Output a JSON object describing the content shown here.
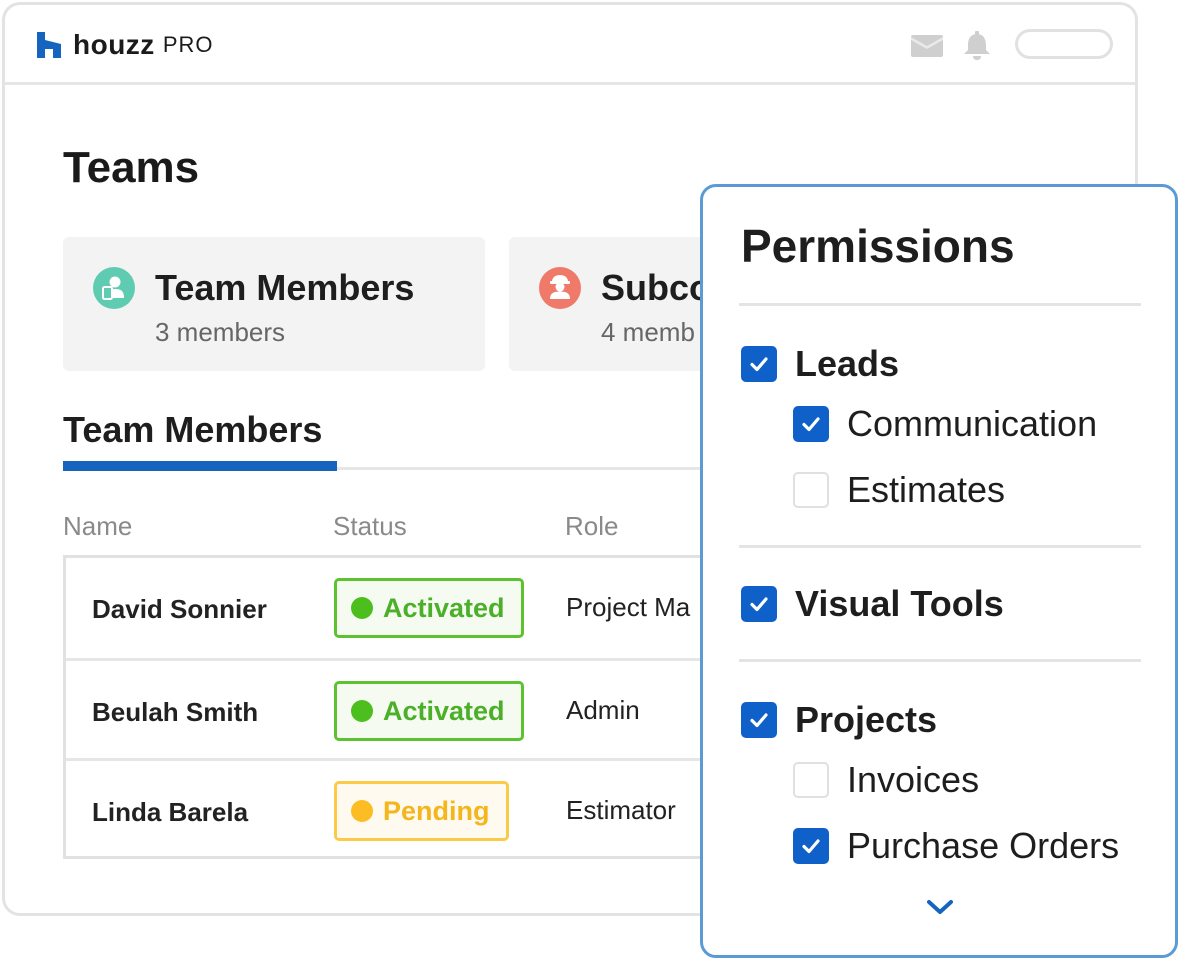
{
  "header": {
    "logo_word": "houzz",
    "logo_suffix": "PRO",
    "icons": [
      "mail-icon",
      "bell-icon",
      "search-input"
    ]
  },
  "page": {
    "title": "Teams"
  },
  "cards": [
    {
      "title": "Team Members",
      "subtitle": "3 members",
      "icon": "team-member-icon",
      "icon_color": "#5fcbb0"
    },
    {
      "title": "Subco",
      "subtitle": "4 memb",
      "icon": "subcontractor-icon",
      "icon_color": "#f07a6a"
    }
  ],
  "section": {
    "heading": "Team Members"
  },
  "table": {
    "columns": [
      "Name",
      "Status",
      "Role"
    ],
    "rows": [
      {
        "name": "David Sonnier",
        "status": "Activated",
        "role": "Project Ma"
      },
      {
        "name": "Beulah Smith",
        "status": "Activated",
        "role": "Admin"
      },
      {
        "name": "Linda Barela",
        "status": "Pending",
        "role": "Estimator"
      }
    ]
  },
  "status_styles": {
    "Activated": {
      "text": "#4caf2a",
      "border": "#5cc22f",
      "bg": "#f5fbf1",
      "dot": "#4cbf1e"
    },
    "Pending": {
      "text": "#f5b51c",
      "border": "#fbcb47",
      "bg": "#fffaf0",
      "dot": "#fbbd23"
    }
  },
  "permissions": {
    "title": "Permissions",
    "groups": [
      {
        "label": "Leads",
        "checked": true,
        "children": [
          {
            "label": "Communication",
            "checked": true
          },
          {
            "label": "Estimates",
            "checked": false
          }
        ]
      },
      {
        "label": "Visual Tools",
        "checked": true,
        "children": []
      },
      {
        "label": "Projects",
        "checked": true,
        "children": [
          {
            "label": "Invoices",
            "checked": false
          },
          {
            "label": "Purchase Orders",
            "checked": true
          }
        ]
      }
    ],
    "more_icon": "chevron-down-icon"
  },
  "colors": {
    "accent": "#1565c0",
    "checkbox": "#1060c9",
    "panel_border": "#5b9bd5",
    "logo": "#1565c0"
  }
}
